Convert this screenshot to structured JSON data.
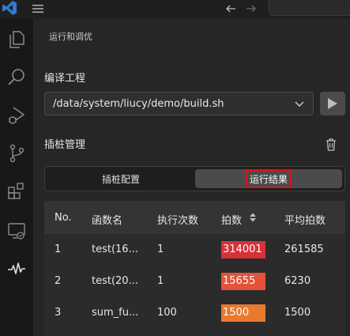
{
  "breadcrumb": "运行和调优",
  "compile": {
    "title": "编译工程",
    "script_path": "/data/system/liucy/demo/build.sh"
  },
  "instrument": {
    "title": "插桩管理",
    "tabs": [
      {
        "label": "插桩配置",
        "active": false
      },
      {
        "label": "运行结果",
        "active": true
      }
    ]
  },
  "results": {
    "headers": [
      "No.",
      "函数名",
      "执行次数",
      "拍数",
      "平均拍数"
    ],
    "rows": [
      {
        "no": "1",
        "name": "test(16...",
        "calls": "1",
        "ticks": "314001",
        "avg": "261585",
        "heat": "#d6323a"
      },
      {
        "no": "2",
        "name": "test(20...",
        "calls": "1",
        "ticks": "15655",
        "avg": "6230",
        "heat": "#e2533a"
      },
      {
        "no": "3",
        "name": "sum_fu...",
        "calls": "100",
        "ticks": "1500",
        "avg": "1500",
        "heat": "#e87a2c"
      }
    ]
  },
  "colors": {
    "accent": "#2f7ad6",
    "highlight_box": "#e0101a"
  },
  "icons": {
    "activity_bar": [
      "explorer-icon",
      "search-icon",
      "run-debug-icon",
      "source-control-icon",
      "extensions-icon",
      "remote-explorer-icon",
      "performance-icon"
    ],
    "titlebar": [
      "vscode-logo",
      "menu-icon",
      "back-arrow-icon",
      "forward-arrow-icon"
    ]
  }
}
